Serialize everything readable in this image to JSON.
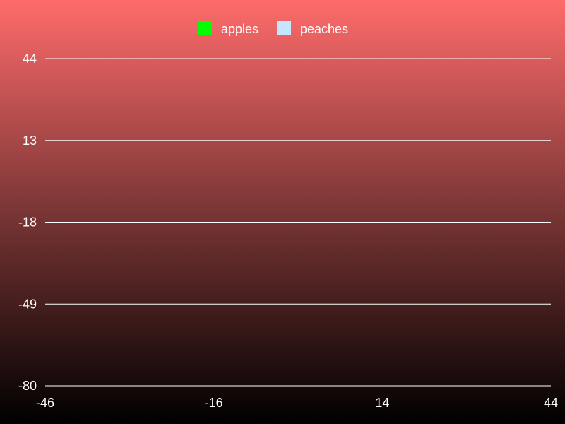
{
  "chart_data": {
    "type": "scatter",
    "title": "",
    "xlabel": "",
    "ylabel": "",
    "x_ticks": [
      "-46",
      "-16",
      "14",
      "44"
    ],
    "y_ticks": [
      "44",
      "13",
      "-18",
      "-49",
      "-80"
    ],
    "xlim": [
      -46,
      44
    ],
    "ylim": [
      -80,
      44
    ],
    "grid": true,
    "legend_position": "top-center",
    "series": [
      {
        "name": "apples",
        "color": "#00ff00",
        "points": []
      },
      {
        "name": "peaches",
        "color": "#c6e6ff",
        "points": []
      }
    ]
  }
}
